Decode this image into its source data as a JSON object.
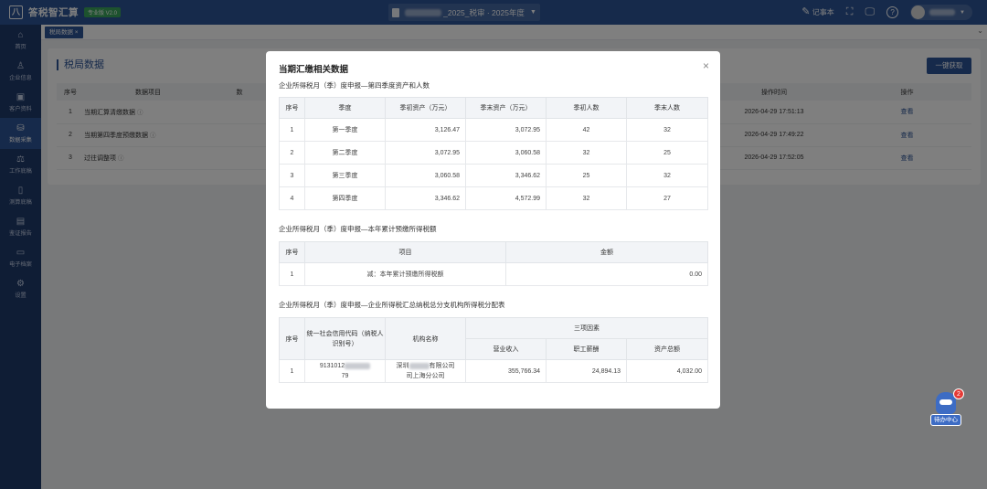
{
  "app": {
    "logo_glyph": "八",
    "name": "答税智汇算",
    "version_badge": "专业版 V2.0"
  },
  "header": {
    "doc_title": "_2025_税审 · 2025年度",
    "notes_label": "记事本",
    "expand_icon": "⛶",
    "monitor_icon": "🖵",
    "help_icon": "?"
  },
  "sidebar": {
    "items": [
      {
        "icon": "⌂",
        "label": "首页"
      },
      {
        "icon": "♙",
        "label": "企业信息"
      },
      {
        "icon": "▣",
        "label": "客户资料"
      },
      {
        "icon": "⛁",
        "label": "数据采集"
      },
      {
        "icon": "⚖",
        "label": "工作底稿"
      },
      {
        "icon": "▯",
        "label": "测算底稿"
      },
      {
        "icon": "▤",
        "label": "鉴证报告"
      },
      {
        "icon": "▭",
        "label": "电子档案"
      },
      {
        "icon": "⚙",
        "label": "设置"
      }
    ]
  },
  "tabs": {
    "active": "税局数据 ×"
  },
  "panel": {
    "title": "税局数据",
    "fetch_button": "一键获取",
    "columns": {
      "seq": "序号",
      "item": "数据项目",
      "col3": "数",
      "time": "操作时间",
      "action": "操作"
    },
    "rows": [
      {
        "seq": "1",
        "item": "当期汇算清缴数据",
        "time": "2026-04-29 17:51:13",
        "action": "查看"
      },
      {
        "seq": "2",
        "item": "当期第四季度预缴数据",
        "time": "2026-04-29 17:49:22",
        "action": "查看"
      },
      {
        "seq": "3",
        "item": "过往调整项",
        "time": "2026-04-29 17:52:05",
        "action": "查看"
      }
    ]
  },
  "modal": {
    "title": "当期汇缴相关数据",
    "close": "×",
    "section1": {
      "title": "企业所得税月（季）度申报—第四季度资产和人数",
      "headers": [
        "序号",
        "季度",
        "季初资产（万元）",
        "季末资产（万元）",
        "季初人数",
        "季末人数"
      ],
      "rows": [
        [
          "1",
          "第一季度",
          "3,126.47",
          "3,072.95",
          "42",
          "32"
        ],
        [
          "2",
          "第二季度",
          "3,072.95",
          "3,060.58",
          "32",
          "25"
        ],
        [
          "3",
          "第三季度",
          "3,060.58",
          "3,346.62",
          "25",
          "32"
        ],
        [
          "4",
          "第四季度",
          "3,346.62",
          "4,572.99",
          "32",
          "27"
        ]
      ]
    },
    "section2": {
      "title": "企业所得税月（季）度申报—本年累计预缴所得税额",
      "headers": [
        "序号",
        "项目",
        "金额"
      ],
      "rows": [
        [
          "1",
          "减：本年累计预缴所得税额",
          "0.00"
        ]
      ]
    },
    "section3": {
      "title": "企业所得税月（季）度申报—企业所得税汇总纳税总分支机构所得税分配表",
      "headers": {
        "seq": "序号",
        "credit_code": "统一社会信用代码（纳税人识别号）",
        "org_name": "机构名称",
        "three_factors": "三项因素",
        "revenue": "营业收入",
        "wages": "职工薪酬",
        "assets": "资产总额"
      },
      "row": {
        "seq": "1",
        "credit_code_prefix": "9131012",
        "credit_code_suffix": "79",
        "org_prefix": "深圳",
        "org_suffix": "有限公司",
        "org_line2": "司上海分公司",
        "revenue": "355,766.34",
        "wages": "24,894.13",
        "assets": "4,032.00"
      }
    }
  },
  "todo": {
    "label": "待办中心",
    "badge": "2"
  }
}
